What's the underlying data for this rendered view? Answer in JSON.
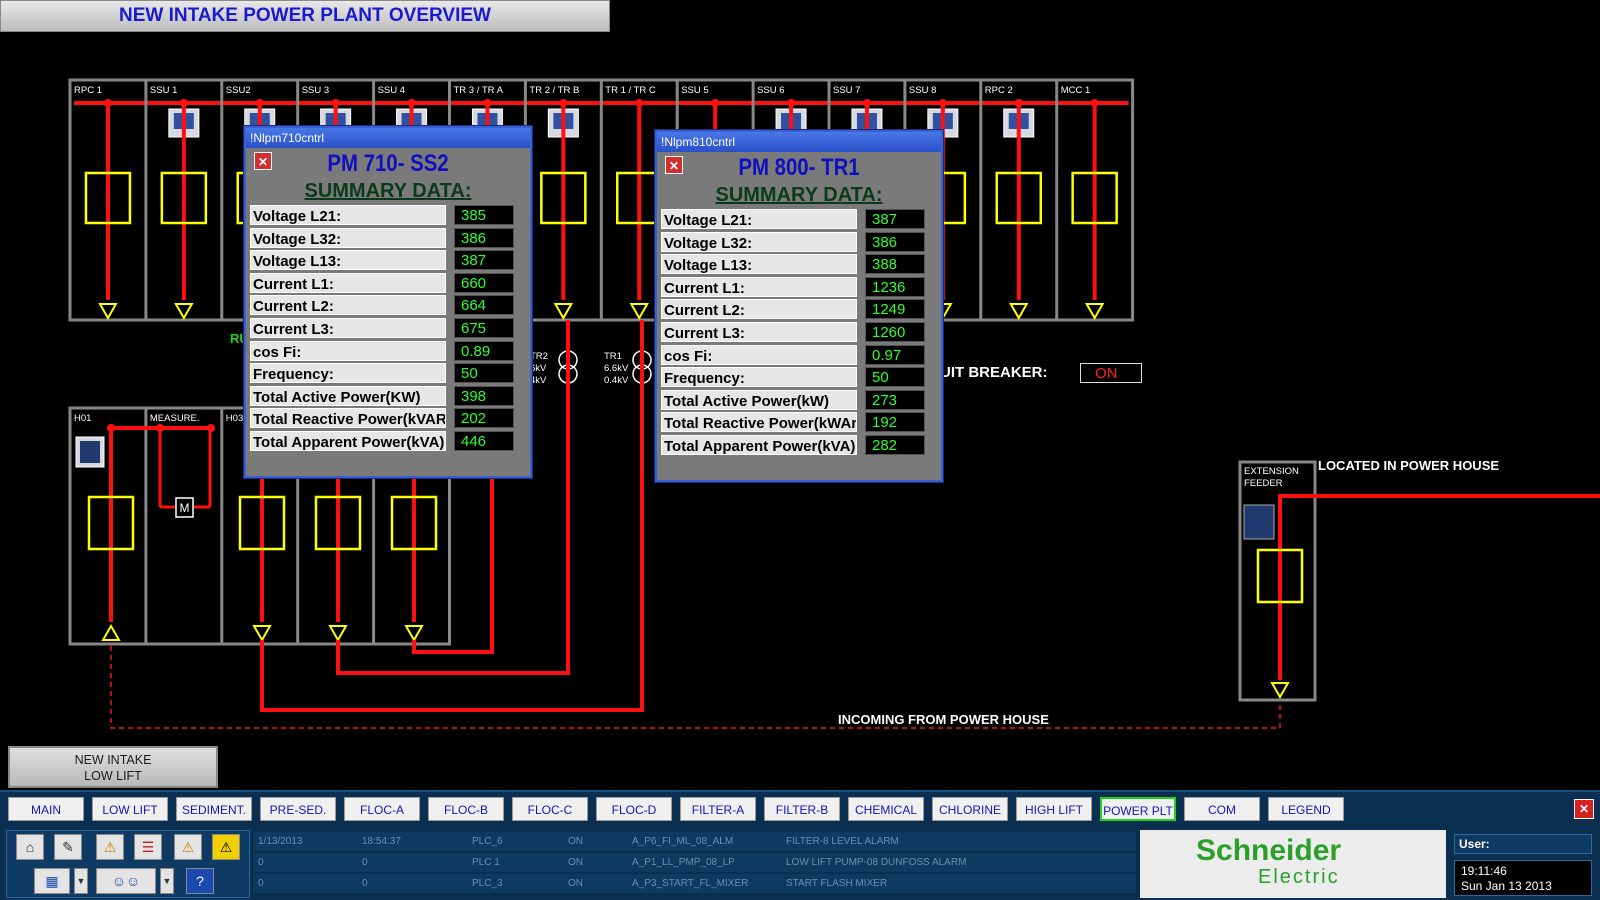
{
  "title": "NEW INTAKE POWER PLANT OVERVIEW",
  "top_cubicles": [
    "RPC 1",
    "SSU 1",
    "SSU2",
    "SSU 3",
    "SSU 4",
    "TR 3 / TR A",
    "TR 2 / TR B",
    "TR 1 / TR C",
    "SSU 5",
    "SSU 6",
    "SSU 7",
    "SSU 8",
    "RPC 2",
    "MCC 1"
  ],
  "bottom_cubicles": [
    "H01",
    "MEASURE.",
    "H03"
  ],
  "breaker_label": "CIRCUIT BREAKER:",
  "breaker_label_visible": "UIT BREAKER:",
  "breaker_status": "ON",
  "tr2": {
    "name": "TR2",
    "hv": "6.6kV",
    "lv": "0.4kV",
    "hv_vis": "6kV",
    "lv_vis": "4kV"
  },
  "tr1": {
    "name": "TR1",
    "hv": "6.6kV",
    "lv": "0.4kV"
  },
  "ru_partial": "RU",
  "measure_symbol": "M",
  "extension_feeder": {
    "line1": "EXTENSION",
    "line2": "FEEDER"
  },
  "located_label": "LOCATED IN POWER HOUSE",
  "incoming_label": "INCOMING FROM POWER HOUSE",
  "area_button": {
    "line1": "NEW INTAKE",
    "line2": "LOW LIFT"
  },
  "pm710": {
    "window_title": "!Nlpm710cntrl",
    "name": "PM 710- SS2",
    "summary": "SUMMARY DATA:",
    "close_symbol": "✕",
    "rows": [
      {
        "label": "Voltage L21:",
        "value": "385"
      },
      {
        "label": "Voltage L32:",
        "value": "386"
      },
      {
        "label": "Voltage L13:",
        "value": "387"
      },
      {
        "label": "Current L1:",
        "value": "660"
      },
      {
        "label": "Current L2:",
        "value": "664"
      },
      {
        "label": "Current L3:",
        "value": "675"
      },
      {
        "label": "cos Fi:",
        "value": "0.89"
      },
      {
        "label": "Frequency:",
        "value": "50"
      },
      {
        "label": "Total Active Power(KW)",
        "value": "398"
      },
      {
        "label": "Total Reactive Power(kVAR",
        "value": "202"
      },
      {
        "label": "Total Apparent Power(kVA)",
        "value": "446"
      }
    ]
  },
  "pm800": {
    "window_title": "!Nlpm810cntrl",
    "name": "PM 800- TR1",
    "summary": "SUMMARY DATA:",
    "close_symbol": "✕",
    "rows": [
      {
        "label": "Voltage L21:",
        "value": "387"
      },
      {
        "label": "Voltage L32:",
        "value": "386"
      },
      {
        "label": "Voltage L13:",
        "value": "388"
      },
      {
        "label": "Current L1:",
        "value": "1236"
      },
      {
        "label": "Current L2:",
        "value": "1249"
      },
      {
        "label": "Current L3:",
        "value": "1260"
      },
      {
        "label": "cos Fi:",
        "value": "0.97"
      },
      {
        "label": "Frequency:",
        "value": "50"
      },
      {
        "label": "Total Active Power(kW)",
        "value": "273"
      },
      {
        "label": "Total Reactive Power(kWAr",
        "value": "192"
      },
      {
        "label": "Total Apparent Power(kVA)",
        "value": "282"
      }
    ]
  },
  "nav": [
    "MAIN",
    "LOW LIFT",
    "SEDIMENT.",
    "PRE-SED.",
    "FLOC-A",
    "FLOC-B",
    "FLOC-C",
    "FLOC-D",
    "FILTER-A",
    "FILTER-B",
    "CHEMICAL",
    "CHLORINE",
    "HIGH LIFT",
    "POWER PLT",
    "COM",
    "LEGEND"
  ],
  "nav_active": "POWER PLT",
  "alarms": [
    {
      "date": "1/13/2013",
      "time": "18:54:37",
      "plc": "PLC_6",
      "state": "ON",
      "tag": "A_P6_FI_ML_08_ALM",
      "desc": "FILTER-8 LEVEL ALARM"
    },
    {
      "date": "0",
      "time": "0",
      "plc": "PLC 1",
      "state": "ON",
      "tag": "A_P1_LL_PMP_08_LP",
      "desc": "LOW LIFT PUMP-08 DUNFOSS ALARM"
    },
    {
      "date": "0",
      "time": "0",
      "plc": "PLC_3",
      "state": "ON",
      "tag": "A_P3_START_FL_MIXER",
      "desc": "START FLASH MIXER"
    }
  ],
  "brand": {
    "line1": "Schneider",
    "line2": "Electric"
  },
  "user_label": "User:",
  "clock_time": "19:11:46",
  "clock_date": "Sun Jan 13 2013",
  "colors": {
    "busbar": "#ff1010",
    "breaker": "#ffff00",
    "value": "#2eff2e",
    "nav_text": "#1414b8",
    "brand_green": "#2aa02a"
  }
}
